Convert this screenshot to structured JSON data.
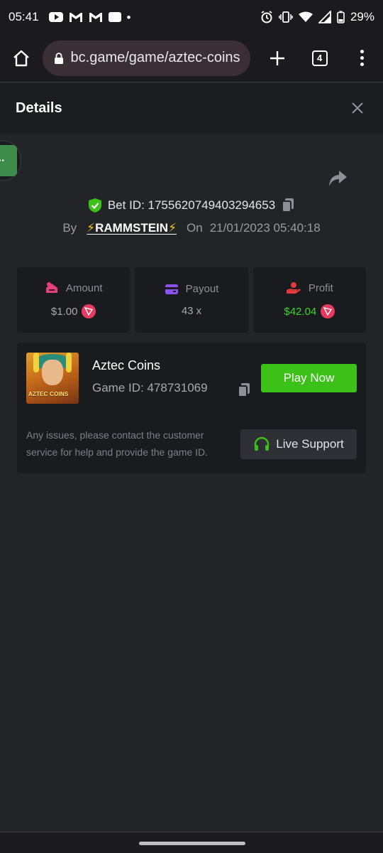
{
  "status_bar": {
    "time": "05:41",
    "battery": "29%",
    "icons": [
      "youtube-icon",
      "gmail-icon",
      "gmail-icon",
      "square-app-icon",
      "dot-icon",
      "alarm-icon",
      "vibrate-icon",
      "wifi-icon",
      "signal-icon",
      "battery-icon"
    ]
  },
  "browser": {
    "url": "bc.game/game/aztec-coins",
    "tab_count": "4"
  },
  "details": {
    "title": "Details",
    "bet_id_label": "Bet ID: 1755620749403294653",
    "by_label": "By",
    "username": "RAMMSTEIN",
    "bolt": "⚡",
    "on_label": "On",
    "date": "21/01/2023 05:40:18"
  },
  "stats": [
    {
      "label": "Amount",
      "value": "$1.00",
      "icon": "amount-icon",
      "color": "#e8417a"
    },
    {
      "label": "Payout",
      "value": "43 x",
      "icon": "payout-card-icon",
      "color": "#8b52f2"
    },
    {
      "label": "Profit",
      "value": "$42.04",
      "icon": "profit-hand-icon",
      "color": "#e23b3b"
    }
  ],
  "game": {
    "name": "Aztec Coins",
    "game_id": "Game ID: 478731069",
    "thumb_text": "AZTEC COINS",
    "play_label": "Play Now",
    "notice": "Any issues, please contact the customer service for help and provide the game ID.",
    "support_label": "Live Support"
  },
  "colors": {
    "accent_green": "#3bc117",
    "profit_green": "#3fd42a",
    "tron_red": "#e73a5e"
  }
}
